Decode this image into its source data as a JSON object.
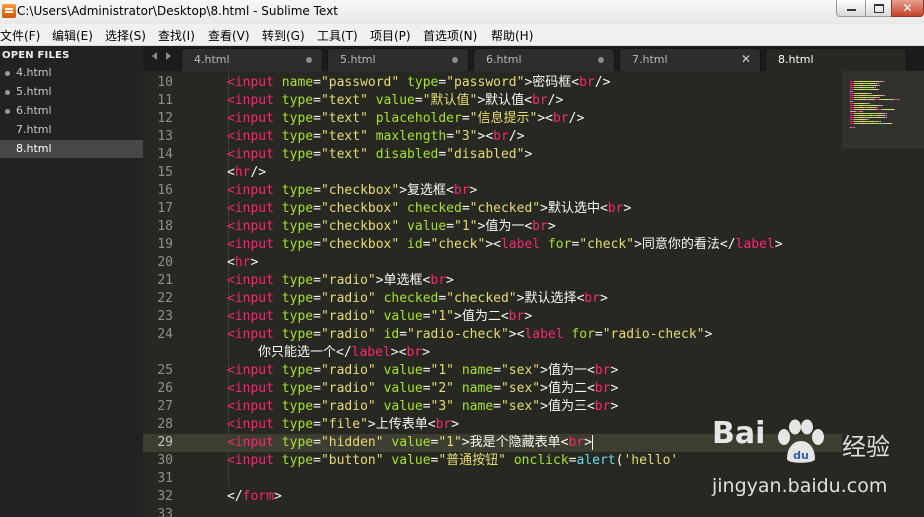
{
  "window": {
    "title": "C:\\Users\\Administrator\\Desktop\\8.html - Sublime Text",
    "close_glyph": "✕"
  },
  "menu": [
    "文件(F)",
    "编辑(E)",
    "选择(S)",
    "查找(I)",
    "查看(V)",
    "转到(G)",
    "工具(T)",
    "项目(P)",
    "首选项(N)",
    "帮助(H)"
  ],
  "sidebar": {
    "header": "OPEN FILES",
    "files": [
      {
        "name": "4.html",
        "modified": true
      },
      {
        "name": "5.html",
        "modified": true
      },
      {
        "name": "6.html",
        "modified": true
      },
      {
        "name": "7.html",
        "modified": false
      },
      {
        "name": "8.html",
        "modified": false,
        "active": true
      }
    ]
  },
  "tabs": [
    {
      "label": "4.html",
      "state": "modified"
    },
    {
      "label": "5.html",
      "state": "modified"
    },
    {
      "label": "6.html",
      "state": "modified"
    },
    {
      "label": "7.html",
      "state": "close"
    },
    {
      "label": "8.html",
      "state": "active"
    }
  ],
  "tab_close_glyph": "✕",
  "editor": {
    "current_line": "29",
    "lines": [
      {
        "n": "10",
        "tokens": [
          [
            "tag",
            "<input"
          ],
          [
            "txt",
            " "
          ],
          [
            "attr",
            "name"
          ],
          [
            "txt",
            "="
          ],
          [
            "str",
            "\"password\""
          ],
          [
            "txt",
            " "
          ],
          [
            "attr",
            "type"
          ],
          [
            "txt",
            "="
          ],
          [
            "str",
            "\"password\""
          ],
          [
            "txt",
            ">密码框<"
          ],
          [
            "tag",
            "br"
          ],
          [
            "txt",
            "/>"
          ]
        ]
      },
      {
        "n": "11",
        "tokens": [
          [
            "tag",
            "<input"
          ],
          [
            "txt",
            " "
          ],
          [
            "attr",
            "type"
          ],
          [
            "txt",
            "="
          ],
          [
            "str",
            "\"text\""
          ],
          [
            "txt",
            " "
          ],
          [
            "attr",
            "value"
          ],
          [
            "txt",
            "="
          ],
          [
            "str",
            "\"默认值\""
          ],
          [
            "txt",
            ">默认值<"
          ],
          [
            "tag",
            "br"
          ],
          [
            "txt",
            "/>"
          ]
        ]
      },
      {
        "n": "12",
        "tokens": [
          [
            "tag",
            "<input"
          ],
          [
            "txt",
            " "
          ],
          [
            "attr",
            "type"
          ],
          [
            "txt",
            "="
          ],
          [
            "str",
            "\"text\""
          ],
          [
            "txt",
            " "
          ],
          [
            "attr",
            "placeholder"
          ],
          [
            "txt",
            "="
          ],
          [
            "str",
            "\"信息提示\""
          ],
          [
            "txt",
            "><"
          ],
          [
            "tag",
            "br"
          ],
          [
            "txt",
            "/>"
          ]
        ]
      },
      {
        "n": "13",
        "tokens": [
          [
            "tag",
            "<input"
          ],
          [
            "txt",
            " "
          ],
          [
            "attr",
            "type"
          ],
          [
            "txt",
            "="
          ],
          [
            "str",
            "\"text\""
          ],
          [
            "txt",
            " "
          ],
          [
            "attr",
            "maxlength"
          ],
          [
            "txt",
            "="
          ],
          [
            "str",
            "\"3\""
          ],
          [
            "txt",
            "><"
          ],
          [
            "tag",
            "br"
          ],
          [
            "txt",
            "/>"
          ]
        ]
      },
      {
        "n": "14",
        "tokens": [
          [
            "tag",
            "<input"
          ],
          [
            "txt",
            " "
          ],
          [
            "attr",
            "type"
          ],
          [
            "txt",
            "="
          ],
          [
            "str",
            "\"text\""
          ],
          [
            "txt",
            " "
          ],
          [
            "attr",
            "disabled"
          ],
          [
            "txt",
            "="
          ],
          [
            "str",
            "\"disabled\""
          ],
          [
            "txt",
            ">"
          ]
        ]
      },
      {
        "n": "15",
        "tokens": [
          [
            "txt",
            "<"
          ],
          [
            "tag",
            "hr"
          ],
          [
            "txt",
            "/>"
          ]
        ]
      },
      {
        "n": "16",
        "tokens": [
          [
            "tag",
            "<input"
          ],
          [
            "txt",
            " "
          ],
          [
            "attr",
            "type"
          ],
          [
            "txt",
            "="
          ],
          [
            "str",
            "\"checkbox\""
          ],
          [
            "txt",
            ">复选框<"
          ],
          [
            "tag",
            "br"
          ],
          [
            "txt",
            ">"
          ]
        ]
      },
      {
        "n": "17",
        "tokens": [
          [
            "tag",
            "<input"
          ],
          [
            "txt",
            " "
          ],
          [
            "attr",
            "type"
          ],
          [
            "txt",
            "="
          ],
          [
            "str",
            "\"checkbox\""
          ],
          [
            "txt",
            " "
          ],
          [
            "attr",
            "checked"
          ],
          [
            "txt",
            "="
          ],
          [
            "str",
            "\"checked\""
          ],
          [
            "txt",
            ">默认选中<"
          ],
          [
            "tag",
            "br"
          ],
          [
            "txt",
            ">"
          ]
        ]
      },
      {
        "n": "18",
        "tokens": [
          [
            "tag",
            "<input"
          ],
          [
            "txt",
            " "
          ],
          [
            "attr",
            "type"
          ],
          [
            "txt",
            "="
          ],
          [
            "str",
            "\"checkbox\""
          ],
          [
            "txt",
            " "
          ],
          [
            "attr",
            "value"
          ],
          [
            "txt",
            "="
          ],
          [
            "str",
            "\"1\""
          ],
          [
            "txt",
            ">值为一<"
          ],
          [
            "tag",
            "br"
          ],
          [
            "txt",
            ">"
          ]
        ]
      },
      {
        "n": "19",
        "tokens": [
          [
            "tag",
            "<input"
          ],
          [
            "txt",
            " "
          ],
          [
            "attr",
            "type"
          ],
          [
            "txt",
            "="
          ],
          [
            "str",
            "\"checkbox\""
          ],
          [
            "txt",
            " "
          ],
          [
            "attr",
            "id"
          ],
          [
            "txt",
            "="
          ],
          [
            "str",
            "\"check\""
          ],
          [
            "txt",
            "><"
          ],
          [
            "tag",
            "label"
          ],
          [
            "txt",
            " "
          ],
          [
            "attr",
            "for"
          ],
          [
            "txt",
            "="
          ],
          [
            "str",
            "\"check\""
          ],
          [
            "txt",
            ">同意你的看法</"
          ],
          [
            "tag",
            "label"
          ],
          [
            "txt",
            ">"
          ]
        ]
      },
      {
        "n": "20",
        "tokens": [
          [
            "txt",
            "<"
          ],
          [
            "tag",
            "hr"
          ],
          [
            "txt",
            ">"
          ]
        ]
      },
      {
        "n": "21",
        "tokens": [
          [
            "tag",
            "<input"
          ],
          [
            "txt",
            " "
          ],
          [
            "attr",
            "type"
          ],
          [
            "txt",
            "="
          ],
          [
            "str",
            "\"radio\""
          ],
          [
            "txt",
            ">单选框<"
          ],
          [
            "tag",
            "br"
          ],
          [
            "txt",
            ">"
          ]
        ]
      },
      {
        "n": "22",
        "tokens": [
          [
            "tag",
            "<input"
          ],
          [
            "txt",
            " "
          ],
          [
            "attr",
            "type"
          ],
          [
            "txt",
            "="
          ],
          [
            "str",
            "\"radio\""
          ],
          [
            "txt",
            " "
          ],
          [
            "attr",
            "checked"
          ],
          [
            "txt",
            "="
          ],
          [
            "str",
            "\"checked\""
          ],
          [
            "txt",
            ">默认选择<"
          ],
          [
            "tag",
            "br"
          ],
          [
            "txt",
            ">"
          ]
        ]
      },
      {
        "n": "23",
        "tokens": [
          [
            "tag",
            "<input"
          ],
          [
            "txt",
            " "
          ],
          [
            "attr",
            "type"
          ],
          [
            "txt",
            "="
          ],
          [
            "str",
            "\"radio\""
          ],
          [
            "txt",
            " "
          ],
          [
            "attr",
            "value"
          ],
          [
            "txt",
            "="
          ],
          [
            "str",
            "\"1\""
          ],
          [
            "txt",
            ">值为二<"
          ],
          [
            "tag",
            "br"
          ],
          [
            "txt",
            ">"
          ]
        ]
      },
      {
        "n": "24",
        "tokens": [
          [
            "tag",
            "<input"
          ],
          [
            "txt",
            " "
          ],
          [
            "attr",
            "type"
          ],
          [
            "txt",
            "="
          ],
          [
            "str",
            "\"radio\""
          ],
          [
            "txt",
            " "
          ],
          [
            "attr",
            "id"
          ],
          [
            "txt",
            "="
          ],
          [
            "str",
            "\"radio-check\""
          ],
          [
            "txt",
            "><"
          ],
          [
            "tag",
            "label"
          ],
          [
            "txt",
            " "
          ],
          [
            "attr",
            "for"
          ],
          [
            "txt",
            "="
          ],
          [
            "str",
            "\"radio-check\""
          ],
          [
            "txt",
            ">"
          ]
        ]
      },
      {
        "n": "",
        "tokens": [
          [
            "txt",
            "你只能选一个</"
          ],
          [
            "tag",
            "label"
          ],
          [
            "txt",
            "><"
          ],
          [
            "tag",
            "br"
          ],
          [
            "txt",
            ">"
          ]
        ]
      },
      {
        "n": "25",
        "tokens": [
          [
            "tag",
            "<input"
          ],
          [
            "txt",
            " "
          ],
          [
            "attr",
            "type"
          ],
          [
            "txt",
            "="
          ],
          [
            "str",
            "\"radio\""
          ],
          [
            "txt",
            " "
          ],
          [
            "attr",
            "value"
          ],
          [
            "txt",
            "="
          ],
          [
            "str",
            "\"1\""
          ],
          [
            "txt",
            " "
          ],
          [
            "attr",
            "name"
          ],
          [
            "txt",
            "="
          ],
          [
            "str",
            "\"sex\""
          ],
          [
            "txt",
            ">值为一<"
          ],
          [
            "tag",
            "br"
          ],
          [
            "txt",
            ">"
          ]
        ]
      },
      {
        "n": "26",
        "tokens": [
          [
            "tag",
            "<input"
          ],
          [
            "txt",
            " "
          ],
          [
            "attr",
            "type"
          ],
          [
            "txt",
            "="
          ],
          [
            "str",
            "\"radio\""
          ],
          [
            "txt",
            " "
          ],
          [
            "attr",
            "value"
          ],
          [
            "txt",
            "="
          ],
          [
            "str",
            "\"2\""
          ],
          [
            "txt",
            " "
          ],
          [
            "attr",
            "name"
          ],
          [
            "txt",
            "="
          ],
          [
            "str",
            "\"sex\""
          ],
          [
            "txt",
            ">值为二<"
          ],
          [
            "tag",
            "br"
          ],
          [
            "txt",
            ">"
          ]
        ]
      },
      {
        "n": "27",
        "tokens": [
          [
            "tag",
            "<input"
          ],
          [
            "txt",
            " "
          ],
          [
            "attr",
            "type"
          ],
          [
            "txt",
            "="
          ],
          [
            "str",
            "\"radio\""
          ],
          [
            "txt",
            " "
          ],
          [
            "attr",
            "value"
          ],
          [
            "txt",
            "="
          ],
          [
            "str",
            "\"3\""
          ],
          [
            "txt",
            " "
          ],
          [
            "attr",
            "name"
          ],
          [
            "txt",
            "="
          ],
          [
            "str",
            "\"sex\""
          ],
          [
            "txt",
            ">值为三<"
          ],
          [
            "tag",
            "br"
          ],
          [
            "txt",
            ">"
          ]
        ]
      },
      {
        "n": "28",
        "tokens": [
          [
            "tag",
            "<input"
          ],
          [
            "txt",
            " "
          ],
          [
            "attr",
            "type"
          ],
          [
            "txt",
            "="
          ],
          [
            "str",
            "\"file\""
          ],
          [
            "txt",
            ">上传表单<"
          ],
          [
            "tag",
            "br"
          ],
          [
            "txt",
            ">"
          ]
        ]
      },
      {
        "n": "29",
        "tokens": [
          [
            "tag",
            "<input"
          ],
          [
            "txt",
            " "
          ],
          [
            "attr",
            "type"
          ],
          [
            "txt",
            "="
          ],
          [
            "str",
            "\"hidden\""
          ],
          [
            "txt",
            " "
          ],
          [
            "attr",
            "value"
          ],
          [
            "txt",
            "="
          ],
          [
            "str",
            "\"1\""
          ],
          [
            "txt",
            ">我是个隐藏表单<"
          ],
          [
            "tag",
            "br"
          ],
          [
            "txt",
            ">"
          ]
        ]
      },
      {
        "n": "30",
        "tokens": [
          [
            "tag",
            "<input"
          ],
          [
            "txt",
            " "
          ],
          [
            "attr",
            "type"
          ],
          [
            "txt",
            "="
          ],
          [
            "str",
            "\"button\""
          ],
          [
            "txt",
            " "
          ],
          [
            "attr",
            "value"
          ],
          [
            "txt",
            "="
          ],
          [
            "str",
            "\"普通按钮\""
          ],
          [
            "txt",
            " "
          ],
          [
            "attr",
            "onclick"
          ],
          [
            "txt",
            "="
          ],
          [
            "fn",
            "alert"
          ],
          [
            "txt",
            "("
          ],
          [
            "str",
            "'hello'"
          ]
        ]
      },
      {
        "n": "31",
        "tokens": []
      },
      {
        "n": "32",
        "tokens": [
          [
            "txt",
            "</"
          ],
          [
            "tag",
            "form"
          ],
          [
            "txt",
            ">"
          ]
        ]
      },
      {
        "n": "33",
        "tokens": []
      }
    ]
  },
  "watermark": {
    "logo": "Bai",
    "logo_icon": "paw-icon",
    "text": "经验",
    "url": "jingyan.baidu.com"
  }
}
